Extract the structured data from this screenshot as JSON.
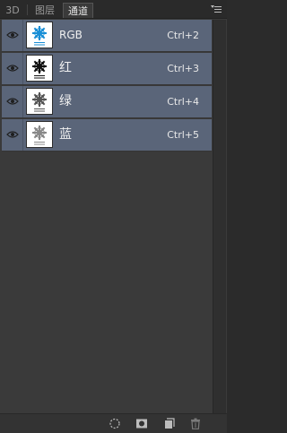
{
  "tabs": [
    {
      "label": "3D",
      "active": false
    },
    {
      "label": "图层",
      "active": false
    },
    {
      "label": "通道",
      "active": true
    }
  ],
  "channels": [
    {
      "name": "RGB",
      "shortcut": "Ctrl+2",
      "thumb_color": "#1a8fd6",
      "visible": true
    },
    {
      "name": "红",
      "shortcut": "Ctrl+3",
      "thumb_color": "#111111",
      "visible": true
    },
    {
      "name": "绿",
      "shortcut": "Ctrl+4",
      "thumb_color": "#555555",
      "visible": true
    },
    {
      "name": "蓝",
      "shortcut": "Ctrl+5",
      "thumb_color": "#888888",
      "visible": true
    }
  ],
  "colors": {
    "selected_row": "#5a6579",
    "panel_bg": "#3a3a3a",
    "tab_active_text": "#e6e6e6"
  },
  "bottom_icons": [
    "dotted-circle-icon",
    "mask-icon",
    "new-channel-icon",
    "trash-icon"
  ]
}
